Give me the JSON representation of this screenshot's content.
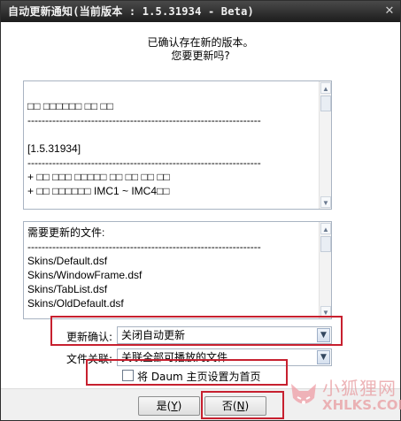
{
  "window": {
    "title": "自动更新通知(当前版本 : 1.5.31934 - Beta)",
    "close_glyph": "✕"
  },
  "message": {
    "line1": "已确认存在新的版本。",
    "line2": "您要更新吗?"
  },
  "changelog": {
    "lines": [
      "",
      "□□ □□□□□□ □□ □□",
      "------------------------------------------------------------------",
      "",
      "[1.5.31934]",
      "------------------------------------------------------------------",
      "+ □□ □□□ □□□□□ □□ □□ □□ □□",
      "+ □□ □□□□□□ IMC1 ~ IMC4□□"
    ]
  },
  "files": {
    "lines": [
      "需要更新的文件:",
      "------------------------------------------------------------------",
      "Skins/Default.dsf",
      "Skins/WindowFrame.dsf",
      "Skins/TabList.dsf",
      "Skins/OldDefault.dsf"
    ]
  },
  "update_confirm": {
    "label": "更新确认:",
    "value": "关闭自动更新"
  },
  "file_assoc": {
    "label": "文件关联:",
    "value": "关联全部可播放的文件"
  },
  "homepage_checkbox": {
    "label": "将 Daum 主页设置为首页",
    "checked": false
  },
  "buttons": {
    "yes": "是",
    "yes_acc": "Y",
    "no": "否",
    "no_acc": "N"
  },
  "colors": {
    "highlight": "#c7202f",
    "titlebar": "#2a2a2a"
  },
  "watermark": {
    "name": "小狐狸网",
    "domain": "XHLKS.COM"
  }
}
